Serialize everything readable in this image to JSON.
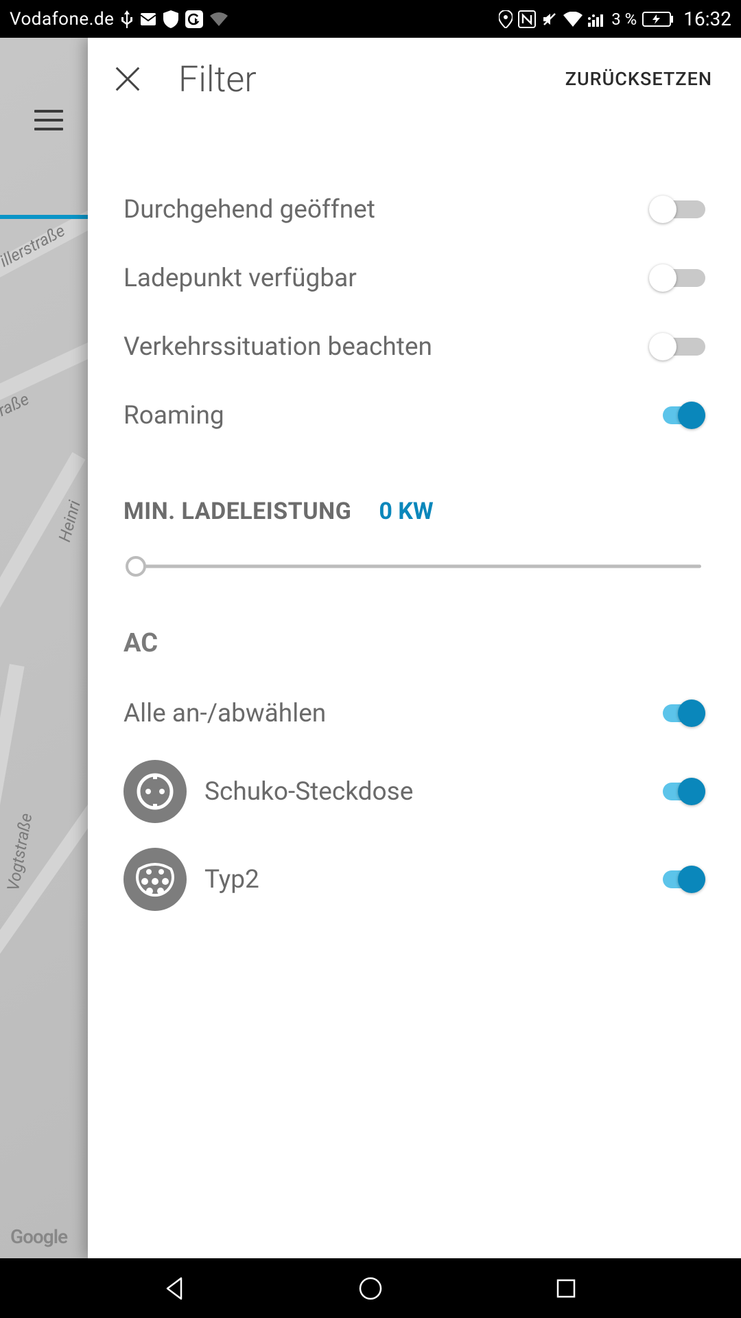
{
  "status": {
    "carrier": "Vodafone.de",
    "battery_pct": "3 %",
    "time": "16:32"
  },
  "map": {
    "street1": "illerstraße",
    "street2": "straße",
    "street3": "Heinri",
    "street4": "Vogtstraße",
    "logo": "Google"
  },
  "panel": {
    "title": "Filter",
    "reset": "ZURÜCKSETZEN",
    "toggles": [
      {
        "label": "Durchgehend geöffnet",
        "on": false
      },
      {
        "label": "Ladepunkt verfügbar",
        "on": false
      },
      {
        "label": "Verkehrssituation beachten",
        "on": false
      },
      {
        "label": "Roaming",
        "on": true
      }
    ],
    "power": {
      "title": "MIN. LADELEISTUNG",
      "value": "0 KW"
    },
    "ac": {
      "header": "AC",
      "select_all": {
        "label": "Alle an-/abwählen",
        "on": true
      },
      "plugs": [
        {
          "label": "Schuko-Steckdose",
          "on": true,
          "icon": "schuko"
        },
        {
          "label": "Typ2",
          "on": true,
          "icon": "type2"
        }
      ]
    }
  }
}
